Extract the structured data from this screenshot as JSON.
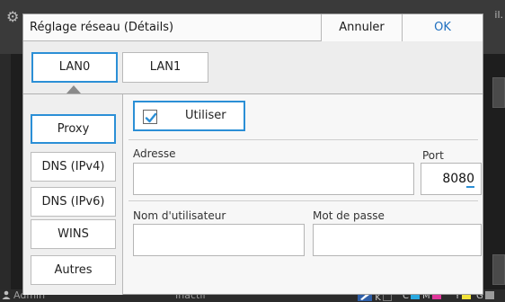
{
  "background": {
    "top_right_text": "il.",
    "status_user": "Admin",
    "status_state": "Inactif",
    "ink_labels": [
      "K",
      "C",
      "M",
      "Y",
      "G"
    ],
    "ink_colors": [
      "#2b2b2b",
      "#29a8e0",
      "#e0389b",
      "#f2e23a",
      "#9a9a9a"
    ]
  },
  "dialog": {
    "title": "Réglage réseau (Détails)",
    "cancel_label": "Annuler",
    "ok_label": "OK"
  },
  "tabs": [
    {
      "label": "LAN0",
      "active": true
    },
    {
      "label": "LAN1",
      "active": false
    }
  ],
  "nav": [
    {
      "label": "Proxy",
      "active": true
    },
    {
      "label": "DNS (IPv4)",
      "active": false
    },
    {
      "label": "DNS (IPv6)",
      "active": false
    },
    {
      "label": "WINS",
      "active": false
    },
    {
      "label": "Autres",
      "active": false
    }
  ],
  "proxy": {
    "use_label": "Utiliser",
    "use_checked": true,
    "address_label": "Adresse",
    "address_value": "",
    "port_label": "Port",
    "port_value_main": "808",
    "port_value_last": "0",
    "username_label": "Nom d'utilisateur",
    "username_value": "",
    "password_label": "Mot de passe",
    "password_value": ""
  },
  "colors": {
    "accent": "#2b8fd6",
    "ok_text": "#1f6fbf"
  }
}
